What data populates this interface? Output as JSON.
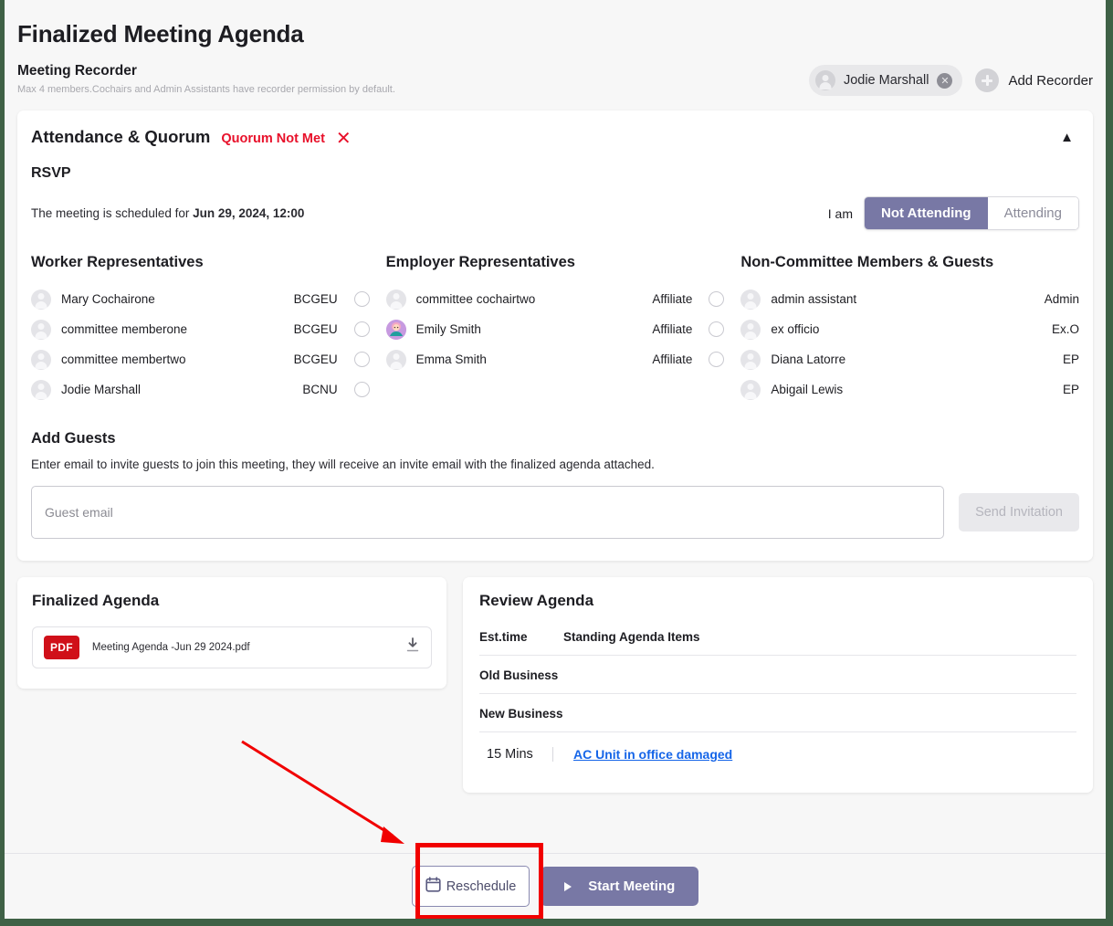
{
  "header": {
    "page_title": "Finalized Meeting Agenda",
    "recorder_title": "Meeting Recorder",
    "recorder_note": "Max 4 members.Cochairs and Admin Assistants have recorder permission by default.",
    "recorder_chip": "Jodie Marshall",
    "add_recorder_label": "Add Recorder"
  },
  "attendance": {
    "title": "Attendance & Quorum",
    "quorum_status": "Quorum Not Met",
    "rsvp_label": "RSVP",
    "schedule_prefix": "The meeting is scheduled for ",
    "schedule_datetime": "Jun 29, 2024, 12:00",
    "i_am_label": "I am",
    "segment_not_attending": "Not Attending",
    "segment_attending": "Attending",
    "selected_segment": "Not Attending"
  },
  "columns": [
    {
      "title": "Worker Representatives",
      "has_radio": true,
      "people": [
        {
          "name": "Mary Cochairone",
          "tag": "BCGEU",
          "avatar": "default"
        },
        {
          "name": "committee memberone",
          "tag": "BCGEU",
          "avatar": "default"
        },
        {
          "name": "committee membertwo",
          "tag": "BCGEU",
          "avatar": "default"
        },
        {
          "name": "Jodie Marshall",
          "tag": "BCNU",
          "avatar": "default"
        }
      ]
    },
    {
      "title": "Employer Representatives",
      "has_radio": true,
      "people": [
        {
          "name": "committee cochairtwo",
          "tag": "Affiliate",
          "avatar": "default"
        },
        {
          "name": "Emily Smith",
          "tag": "Affiliate",
          "avatar": "picture"
        },
        {
          "name": "Emma Smith",
          "tag": "Affiliate",
          "avatar": "default"
        }
      ]
    },
    {
      "title": "Non-Committee Members & Guests",
      "has_radio": false,
      "people": [
        {
          "name": "admin assistant",
          "tag": "Admin",
          "avatar": "default"
        },
        {
          "name": "ex officio",
          "tag": "Ex.O",
          "avatar": "default"
        },
        {
          "name": "Diana Latorre",
          "tag": "EP",
          "avatar": "default"
        },
        {
          "name": "Abigail Lewis",
          "tag": "EP",
          "avatar": "default"
        }
      ]
    }
  ],
  "add_guests": {
    "title": "Add Guests",
    "description": "Enter email to invite guests to join this meeting, they will receive an invite email with the finalized agenda attached.",
    "input_placeholder": "Guest email",
    "input_value": "",
    "send_label": "Send Invitation"
  },
  "finalized_agenda": {
    "title": "Finalized Agenda",
    "file_badge": "PDF",
    "file_name": "Meeting Agenda -Jun 29 2024.pdf"
  },
  "review_agenda": {
    "title": "Review Agenda",
    "col_time": "Est.time",
    "col_items": "Standing Agenda Items",
    "rows": [
      "Old Business",
      "New Business"
    ],
    "item_time": "15 Mins",
    "item_link": "AC Unit in office damaged"
  },
  "footer": {
    "reschedule_label": "Reschedule",
    "start_label": "Start Meeting"
  },
  "colors": {
    "accent_purple": "#7878a5",
    "danger_red": "#e8102a",
    "link_blue": "#1565e8",
    "pdf_red": "#d01019",
    "annotation_red": "#f10000",
    "frame_green": "#3f6146"
  }
}
